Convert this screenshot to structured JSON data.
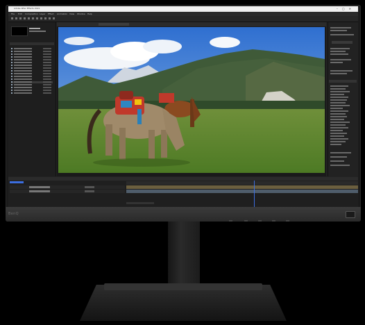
{
  "monitor": {
    "brand": "BenQ"
  },
  "app": {
    "title": "Adobe After Effects 2021",
    "menus": [
      "File",
      "Edit",
      "Composition",
      "Layer",
      "Effect",
      "Animation",
      "View",
      "Window",
      "Help"
    ]
  },
  "colors": {
    "accent": "#3c6ee0",
    "panel": "#1e1e1e",
    "track": "#6b5f3f"
  }
}
